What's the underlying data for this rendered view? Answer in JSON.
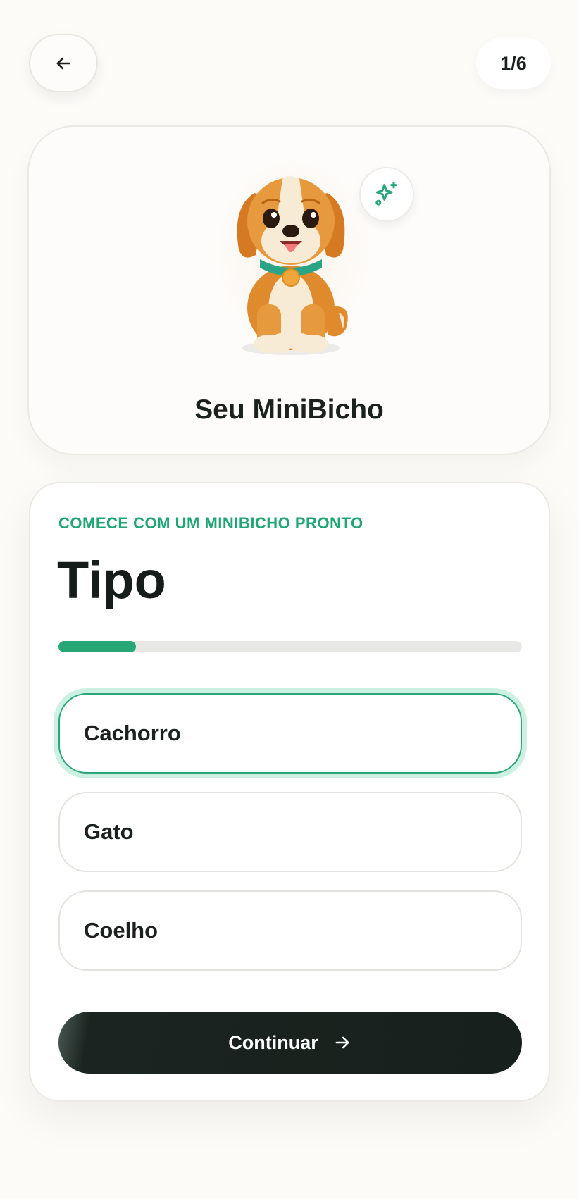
{
  "header": {
    "back_icon": "arrow-left-icon",
    "step": "1/6"
  },
  "hero": {
    "pet_image": "dog-illustration",
    "sparkle_icon": "sparkles-icon",
    "title": "Seu MiniBicho"
  },
  "form": {
    "eyebrow": "COMECE COM UM MINIBICHO PRONTO",
    "title": "Tipo",
    "progress": 0.167,
    "options": [
      {
        "label": "Cachorro",
        "selected": true
      },
      {
        "label": "Gato",
        "selected": false
      },
      {
        "label": "Coelho",
        "selected": false
      }
    ],
    "continue_label": "Continuar",
    "continue_icon": "arrow-right-icon"
  },
  "colors": {
    "accent": "#27a676",
    "selected_ring": "#ccf1e2",
    "button_dark": "#18201d",
    "background": "#fcfbf8"
  }
}
